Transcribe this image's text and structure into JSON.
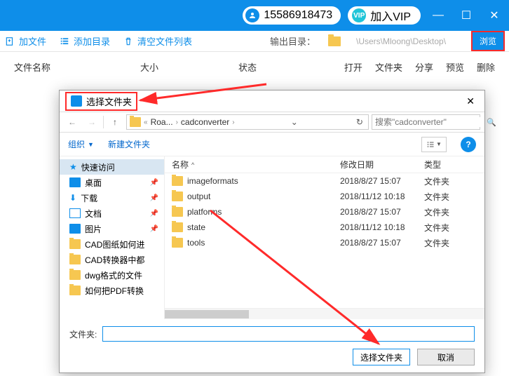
{
  "titlebar": {
    "phone": "15586918473",
    "vip_badge": "VIP",
    "vip_label": "加入VIP"
  },
  "toolbar": {
    "add_file": "加文件",
    "add_dir": "添加目录",
    "clear_list": "清空文件列表",
    "output_label": "输出目录：",
    "output_path": "\\Users\\Mloong\\Desktop\\",
    "browse": "浏览"
  },
  "list_header": {
    "name": "文件名称",
    "size": "大小",
    "status": "状态",
    "open": "打开",
    "folder": "文件夹",
    "share": "分享",
    "preview": "预览",
    "delete": "删除"
  },
  "dialog": {
    "title": "选择文件夹",
    "crumbs": [
      "Roa...",
      "cadconverter"
    ],
    "search_placeholder": "搜索\"cadconverter\"",
    "organize": "组织",
    "new_folder": "新建文件夹",
    "hdr_name": "名称",
    "hdr_date": "修改日期",
    "hdr_type": "类型",
    "tree": {
      "quick": "快速访问",
      "desktop": "桌面",
      "downloads": "下载",
      "documents": "文档",
      "pictures": "图片",
      "items": [
        "CAD图纸如何进",
        "CAD转换器中都",
        "dwg格式的文件",
        "如何把PDF转换"
      ]
    },
    "files": [
      {
        "name": "imageformats",
        "date": "2018/8/27 15:07",
        "type": "文件夹"
      },
      {
        "name": "output",
        "date": "2018/11/12 10:18",
        "type": "文件夹"
      },
      {
        "name": "platforms",
        "date": "2018/8/27 15:07",
        "type": "文件夹"
      },
      {
        "name": "state",
        "date": "2018/11/12 10:18",
        "type": "文件夹"
      },
      {
        "name": "tools",
        "date": "2018/8/27 15:07",
        "type": "文件夹"
      }
    ],
    "folder_label": "文件夹:",
    "select_btn": "选择文件夹",
    "cancel_btn": "取消"
  }
}
